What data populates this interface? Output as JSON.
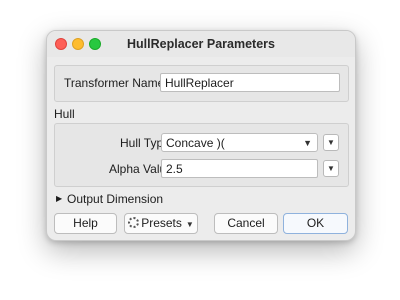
{
  "window": {
    "title": "HullReplacer Parameters"
  },
  "transformer": {
    "name_label": "Transformer Name:",
    "name_value": "HullReplacer"
  },
  "hull": {
    "section_title": "Hull",
    "type_label": "Hull Type:",
    "type_value": "Concave )(",
    "alpha_label": "Alpha Value:",
    "alpha_value": "2.5"
  },
  "output_dimension": {
    "label": "Output Dimension"
  },
  "buttons": {
    "help": "Help",
    "presets": "Presets",
    "cancel": "Cancel",
    "ok": "OK"
  },
  "icons": {
    "close": "close-traffic-light",
    "minimize": "minimize-traffic-light",
    "maximize": "maximize-traffic-light",
    "dropdown": "chevron-down-icon",
    "gear": "gear-icon",
    "disclosure": "triangle-right-icon"
  },
  "colors": {
    "close": "#fe5f57",
    "minimize": "#febc2e",
    "maximize": "#28c840",
    "default_button_border": "#8fb2dd"
  }
}
